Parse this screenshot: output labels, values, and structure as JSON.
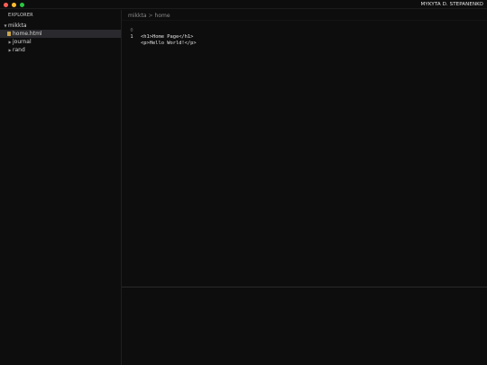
{
  "window": {
    "user": "MYKYTA D. STEPANENKO",
    "traffic_lights": {
      "close": "#ff5f57",
      "minimize": "#febc2e",
      "maximize": "#28c840"
    }
  },
  "sidebar": {
    "title": "EXPLORER",
    "root": {
      "label": "mikkta",
      "expanded": true
    },
    "items": [
      {
        "label": "home.html",
        "type": "file",
        "selected": true,
        "icon": "html-file-icon"
      },
      {
        "label": "journal",
        "type": "folder",
        "expanded": false,
        "icon": "chevron-right-icon"
      },
      {
        "label": "rand",
        "type": "folder",
        "expanded": false,
        "icon": "chevron-right-icon"
      }
    ]
  },
  "editor": {
    "breadcrumb": [
      "mikkta",
      "home"
    ],
    "breadcrumb_sep": ">",
    "lines": [
      {
        "number": "0",
        "text": "<h1>Home Page</h1>",
        "active": false
      },
      {
        "number": "1",
        "text": "<p>Hello World!</p>",
        "active": true
      }
    ]
  },
  "colors": {
    "background": "#0d0d0d",
    "selection": "#2a2a2e"
  }
}
